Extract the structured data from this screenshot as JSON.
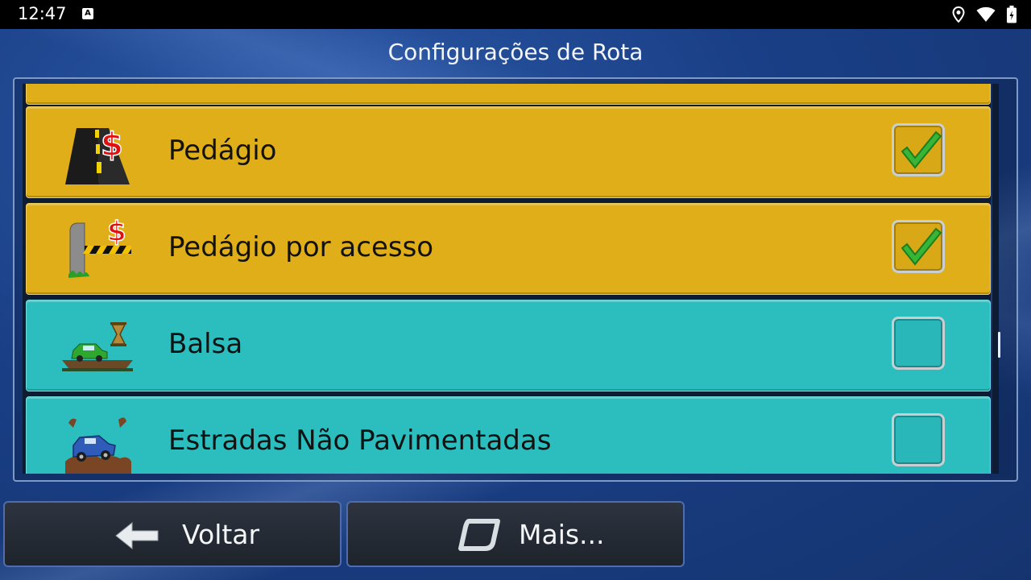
{
  "status_bar": {
    "time": "12:47",
    "notification_icon": "a-notification-icon",
    "icons": [
      "location-icon",
      "wifi-icon",
      "battery-icon"
    ]
  },
  "header": {
    "title": "Configurações de Rota"
  },
  "route_options": [
    {
      "label": "Pedágio",
      "icon": "toll-road-icon",
      "checked": true,
      "color": "#dfae18"
    },
    {
      "label": "Pedágio por acesso",
      "icon": "toll-gate-icon",
      "checked": true,
      "color": "#dfae18"
    },
    {
      "label": "Balsa",
      "icon": "ferry-icon",
      "checked": false,
      "color": "#2cbdbf"
    },
    {
      "label": "Estradas Não Pavimentadas",
      "icon": "unpaved-road-icon",
      "checked": false,
      "color": "#2cbdbf"
    }
  ],
  "footer": {
    "back_label": "Voltar",
    "more_label": "Mais..."
  },
  "colors": {
    "restricted_row": "#dfae18",
    "allowed_row": "#2cbdbf",
    "check": "#33b233",
    "background": "#1a3f86"
  }
}
